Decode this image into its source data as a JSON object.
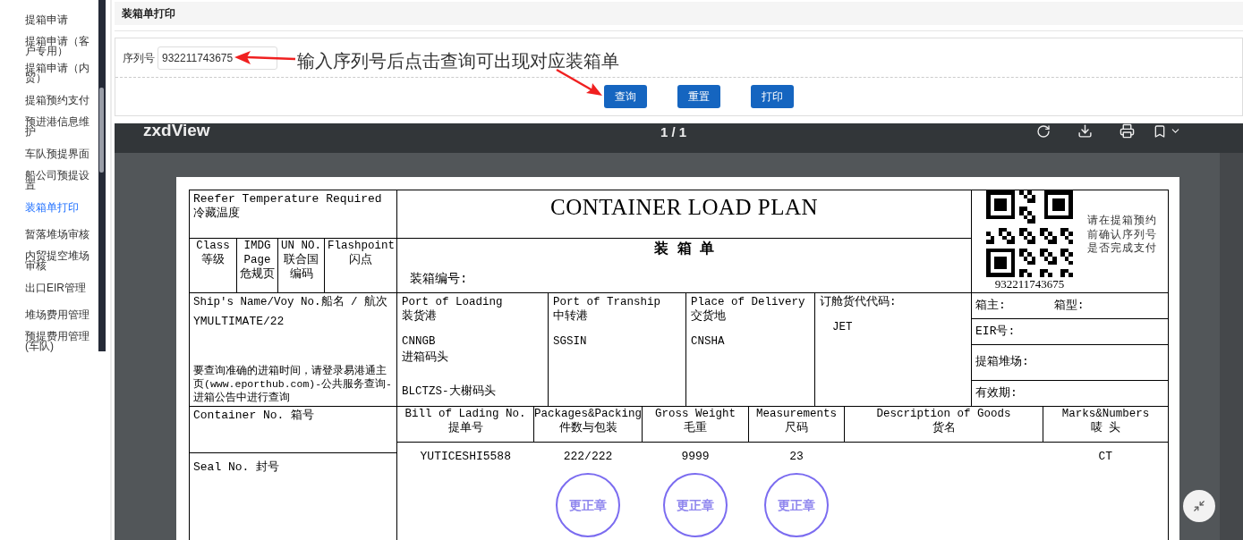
{
  "sidebar": {
    "items": [
      {
        "label": "提箱申请",
        "selected": false
      },
      {
        "label": "提箱申请（客户专用）",
        "selected": false
      },
      {
        "label": "提箱申请（内贸）",
        "selected": false
      },
      {
        "label": "提箱预约支付",
        "selected": false
      },
      {
        "label": "预进港信息维护",
        "selected": false
      },
      {
        "label": "车队预提界面",
        "selected": false
      },
      {
        "label": "船公司预提设置",
        "selected": false
      },
      {
        "label": "装箱单打印",
        "selected": true
      },
      {
        "label": "暂落堆场审核",
        "selected": false
      },
      {
        "label": "内贸提空堆场审核",
        "selected": false
      },
      {
        "label": "出口EIR管理",
        "selected": false
      },
      {
        "label": "堆场费用管理",
        "selected": false
      },
      {
        "label": "预提费用管理(车队)",
        "selected": false
      }
    ]
  },
  "page_title": "装箱单打印",
  "form": {
    "label": "序列号",
    "value": "932211743675"
  },
  "annotation": "输入序列号后点击查询可出现对应装箱单",
  "buttons": [
    "查询",
    "重置",
    "打印"
  ],
  "viewer": {
    "brand": "zxdView",
    "page_indicator": "1 / 1"
  },
  "document": {
    "reefer": [
      "Reefer Temperature Required",
      "冷藏温度"
    ],
    "title": "CONTAINER LOAD PLAN",
    "subtitle": "装 箱 单",
    "number_label": "装箱编号:",
    "qr_number": "932211743675",
    "qr_note": "请在提箱预约前确认序列号是否完成支付",
    "hazard_columns": [
      {
        "en": "Class",
        "zh": "等级"
      },
      {
        "en": "IMDG Page",
        "zh": "危规页"
      },
      {
        "en": "UN NO.",
        "zh": "联合国编码"
      },
      {
        "en": "Flashpoint",
        "zh": "闪点"
      }
    ],
    "ship": {
      "label": "Ship's Name/Voy No.船名 / 航次",
      "value": "YMULTIMATE/22",
      "note": "要查询准确的进箱时间，请登录易港通主页(www.eporthub.com)-公共服务查询-进箱公告中进行查询"
    },
    "ports": [
      {
        "labels": [
          "Port of Loading",
          "装货港"
        ],
        "value": "CNNGB",
        "extra_label": "进箱码头",
        "extra_value": "BLCTZS-大榭码头"
      },
      {
        "labels": [
          "Port of Tranship",
          "中转港"
        ],
        "value": "SGSIN"
      },
      {
        "labels": [
          "Place of Delivery",
          "交货地"
        ],
        "value": "CNSHA"
      },
      {
        "labels": [
          "订舱货代代码:"
        ],
        "value": "JET"
      }
    ],
    "info_rows": [
      [
        "箱主:",
        "箱型:"
      ],
      [
        "EIR号:"
      ],
      [
        "提箱堆场:"
      ],
      [
        "有效期:"
      ]
    ],
    "container_label": "Container No. 箱号",
    "seal_label": "Seal No. 封号",
    "cargo_columns": [
      {
        "en": "Bill of Lading No.",
        "zh": "提单号",
        "value": "YUTICESHI5588"
      },
      {
        "en": "Packages&Packing",
        "zh": "件数与包装",
        "value": "222/222",
        "stamp": "更正章"
      },
      {
        "en": "Gross Weight",
        "zh": "毛重",
        "value": "9999",
        "stamp": "更正章"
      },
      {
        "en": "Measurements",
        "zh": "尺码",
        "value": "23",
        "stamp": "更正章"
      },
      {
        "en": "Description of Goods",
        "zh": "货名"
      },
      {
        "en": "Marks&Numbers",
        "zh": "唛 头",
        "value": "CT"
      }
    ]
  }
}
